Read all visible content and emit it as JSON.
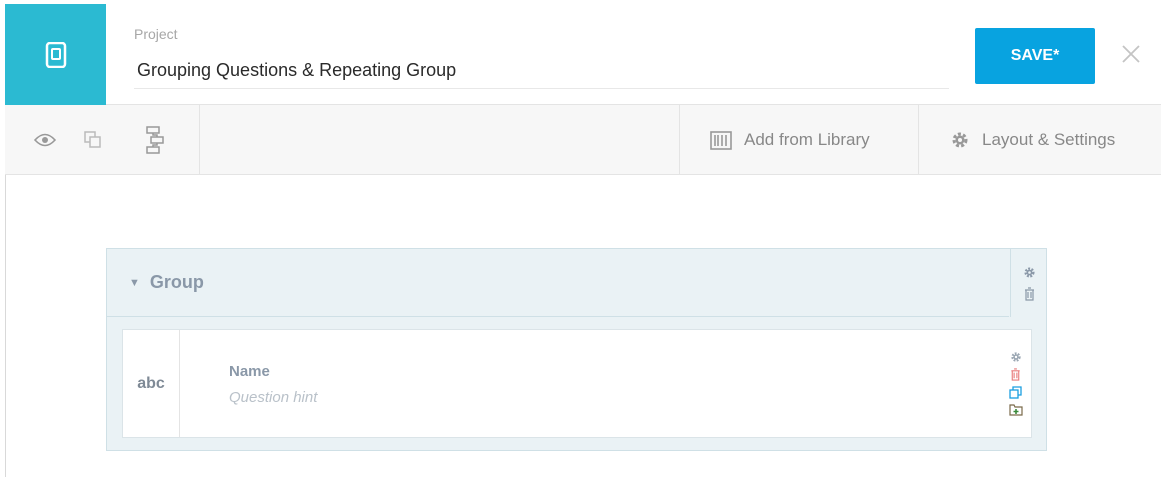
{
  "header": {
    "project_label": "Project",
    "project_name": "Grouping Questions & Repeating Group",
    "save_label": "SAVE*"
  },
  "toolbar": {
    "add_from_library": "Add from Library",
    "layout_settings": "Layout & Settings"
  },
  "group": {
    "title": "Group",
    "caret": "▼",
    "question": {
      "type_label": "abc",
      "name": "Name",
      "hint": "Question hint"
    }
  },
  "icons": [
    "app-logo-icon",
    "close-icon",
    "preview-eye-icon",
    "duplicate-icon",
    "logic-flow-icon",
    "library-icon",
    "gear-icon",
    "trash-icon",
    "copy-icon",
    "add-to-library-icon"
  ],
  "colors": {
    "brand": "#2bbad2",
    "save": "#08a3e0",
    "delete": "#e87a7a",
    "copy": "#1a9ee0",
    "add_library": "#3a8a3a"
  }
}
